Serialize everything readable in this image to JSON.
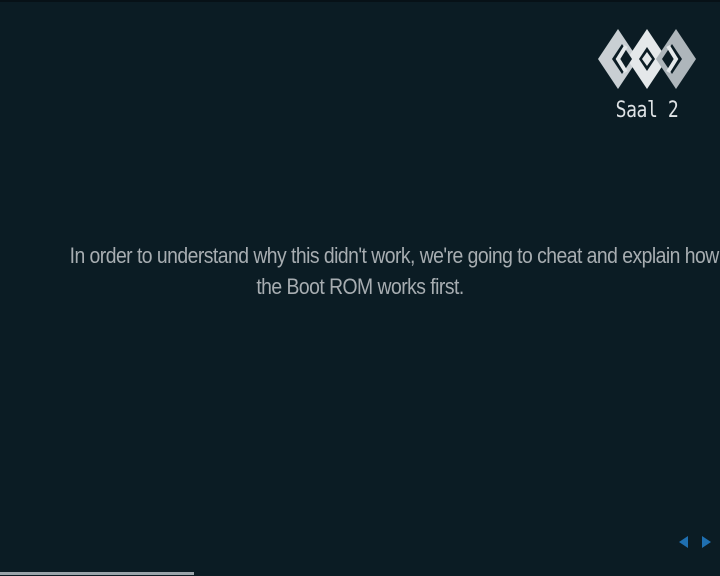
{
  "room": {
    "label": "Saal 2",
    "logo_icon": "conference-logo-icon"
  },
  "slide": {
    "lines": [
      "In order to understand why this didn't work, we're going to cheat and explain how",
      "the Boot ROM works first."
    ]
  },
  "navigation": {
    "prev_icon": "arrow-left-icon",
    "next_icon": "arrow-right-icon",
    "arrow_color": "#1f6fb0"
  },
  "progress": {
    "fraction": 0.27
  },
  "colors": {
    "background": "#0b1c24",
    "text": "#a7adb1",
    "logo_light": "#d7dcdf",
    "logo_dark": "#8e979c"
  }
}
